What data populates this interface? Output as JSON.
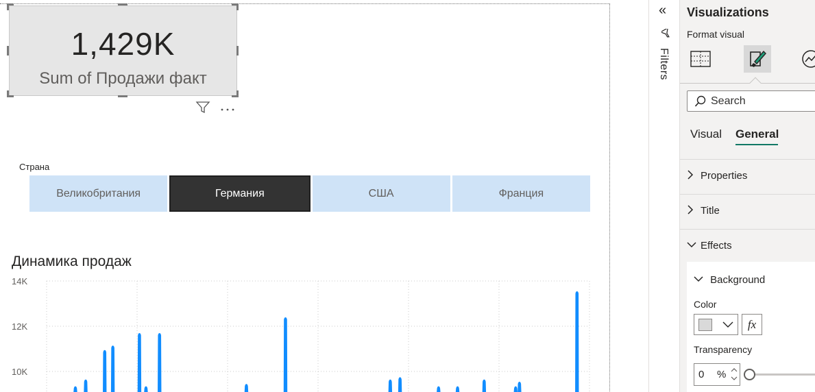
{
  "kpi_card": {
    "value": "1,429K",
    "label": "Sum of Продажи факт"
  },
  "slicer": {
    "title": "Страна",
    "options": [
      {
        "label": "Великобритания",
        "selected": false
      },
      {
        "label": "Германия",
        "selected": true
      },
      {
        "label": "США",
        "selected": false
      },
      {
        "label": "Франция",
        "selected": false
      }
    ]
  },
  "chart_title": "Динамика продаж",
  "chart_data": {
    "type": "line",
    "title": "Динамика продаж",
    "ylim": [
      9300,
      14000
    ],
    "y_ticks": [
      "14K",
      "12K",
      "10K"
    ],
    "y_tick_values": [
      14000,
      12000,
      10000
    ],
    "grid": true,
    "series_color": "#118DFF",
    "spikes": [
      {
        "x": 0.053,
        "y": 9300
      },
      {
        "x": 0.072,
        "y": 9600
      },
      {
        "x": 0.107,
        "y": 10900
      },
      {
        "x": 0.122,
        "y": 11100
      },
      {
        "x": 0.171,
        "y": 11650
      },
      {
        "x": 0.183,
        "y": 9300
      },
      {
        "x": 0.208,
        "y": 11650
      },
      {
        "x": 0.368,
        "y": 9400
      },
      {
        "x": 0.44,
        "y": 12350
      },
      {
        "x": 0.633,
        "y": 9600
      },
      {
        "x": 0.651,
        "y": 9700
      },
      {
        "x": 0.722,
        "y": 9300
      },
      {
        "x": 0.757,
        "y": 9300
      },
      {
        "x": 0.806,
        "y": 9600
      },
      {
        "x": 0.864,
        "y": 9300
      },
      {
        "x": 0.871,
        "y": 9500
      },
      {
        "x": 0.977,
        "y": 13500
      }
    ]
  },
  "filters_pane": {
    "label": "Filters",
    "collapse_glyph": "«"
  },
  "visualizations_pane": {
    "title": "Visualizations",
    "subtitle": "Format visual",
    "search": {
      "placeholder": "Search"
    },
    "tabs": [
      "Visual",
      "General"
    ],
    "active_tab": "General",
    "sections": [
      "Properties",
      "Title",
      "Effects"
    ],
    "background": {
      "header": "Background",
      "color_label": "Color",
      "color_value": "#D9D9D9",
      "fx_label": "fx",
      "transparency_label": "Transparency",
      "transparency_value": "0",
      "transparency_unit": "%"
    }
  }
}
